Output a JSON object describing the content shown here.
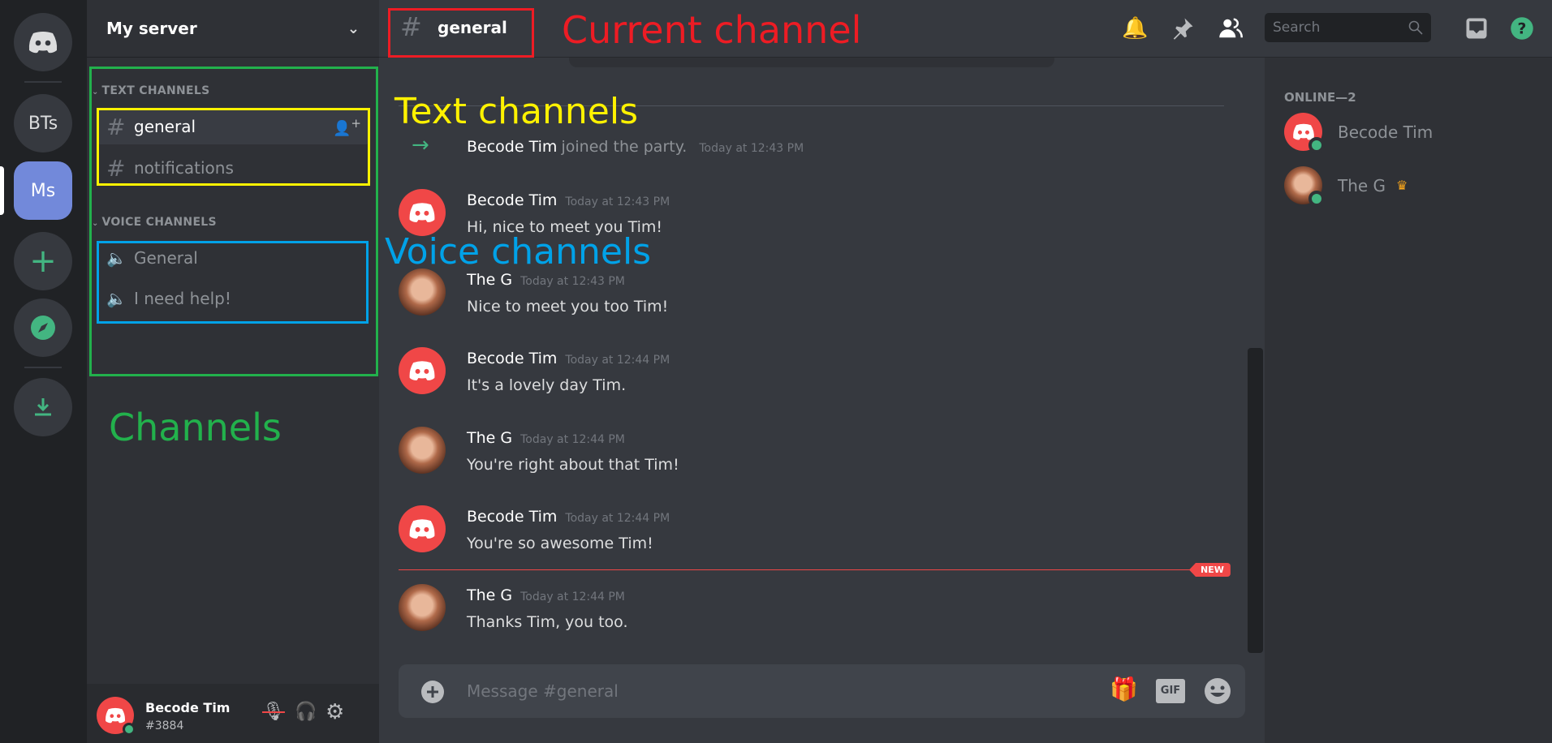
{
  "servers": [
    {
      "label": "BTs"
    },
    {
      "label": "Ms",
      "active": true
    }
  ],
  "server_name": "My server",
  "categories": {
    "text": "TEXT CHANNELS",
    "voice": "VOICE CHANNELS"
  },
  "text_channels": [
    {
      "name": "general",
      "active": true
    },
    {
      "name": "notifications"
    }
  ],
  "voice_channels": [
    {
      "name": "General"
    },
    {
      "name": "I need help!"
    }
  ],
  "user": {
    "name": "Becode Tim",
    "tag": "#3884",
    "status": "online"
  },
  "header": {
    "channel": "general",
    "search_placeholder": "Search"
  },
  "join": {
    "user": "Becode Tim",
    "text": "joined the party.",
    "time": "Today at 12:43 PM"
  },
  "messages": [
    {
      "author": "Becode Tim",
      "avatar": "discord",
      "time": "Today at 12:43 PM",
      "text": "Hi, nice to meet you Tim!"
    },
    {
      "author": "The G",
      "avatar": "photo",
      "time": "Today at 12:43 PM",
      "text": "Nice to meet you too Tim!"
    },
    {
      "author": "Becode Tim",
      "avatar": "discord",
      "time": "Today at 12:44 PM",
      "text": "It's a lovely day Tim."
    },
    {
      "author": "The G",
      "avatar": "photo",
      "time": "Today at 12:44 PM",
      "text": "You're right about that Tim!"
    },
    {
      "author": "Becode Tim",
      "avatar": "discord",
      "time": "Today at 12:44 PM",
      "text": "You're so awesome Tim!"
    },
    {
      "author": "The G",
      "avatar": "photo",
      "time": "Today at 12:44 PM",
      "text": "Thanks Tim, you too."
    }
  ],
  "new_label": "NEW",
  "composer": {
    "placeholder": "Message #general",
    "gif": "GIF"
  },
  "members": {
    "heading": "ONLINE—2",
    "list": [
      {
        "name": "Becode Tim",
        "avatar": "discord"
      },
      {
        "name": "The G",
        "avatar": "photo",
        "owner": true
      }
    ]
  },
  "annotations": {
    "current_channel": "Current channel",
    "text_channels": "Text channels",
    "voice_channels": "Voice channels",
    "channels": "Channels"
  },
  "colors": {
    "accent": "#7289da",
    "online": "#43b581",
    "danger": "#f04747",
    "annotation_red": "#ed1c24",
    "annotation_yellow": "#fff200",
    "annotation_blue": "#00a2e8",
    "annotation_green": "#22b14c"
  }
}
